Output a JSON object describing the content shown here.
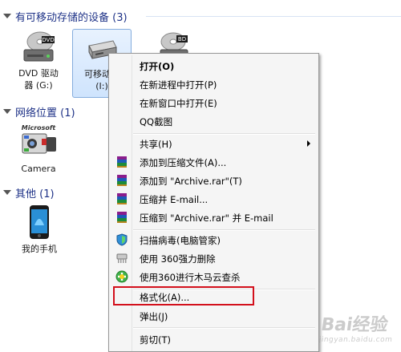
{
  "groups": {
    "removable": "有可移动存储的设备 (3)",
    "network": "网络位置 (1)",
    "other": "其他 (1)"
  },
  "devices": {
    "dvd": {
      "line1": "DVD 驱动",
      "line2": "器 (G:)",
      "badge": "DVD"
    },
    "removable": {
      "line1": "可移动磁",
      "line2": "(I:)"
    },
    "bd": {
      "badge": "BD"
    },
    "camera": {
      "label": "Camera",
      "badge": "Microsoft"
    },
    "phone": {
      "label": "我的手机"
    }
  },
  "context_menu": {
    "open": "打开(O)",
    "open_new_process": "在新进程中打开(P)",
    "open_new_window": "在新窗口中打开(E)",
    "qq_screenshot": "QQ截图",
    "share": "共享(H)",
    "add_to_archive": "添加到压缩文件(A)...",
    "add_to_rar": "添加到 \"Archive.rar\"(T)",
    "compress_email": "压缩并 E-mail...",
    "compress_rar_email": "压缩到 \"Archive.rar\" 并 E-mail",
    "scan_virus": "扫描病毒(电脑管家)",
    "force_delete_360": "使用 360强力删除",
    "trojan_scan_360": "使用360进行木马云查杀",
    "format": "格式化(A)...",
    "eject": "弹出(J)",
    "cut": "剪切(T)"
  },
  "watermark": {
    "brand": "Bai经验",
    "url": "jingyan.baidu.com"
  },
  "colors": {
    "highlight_box": "#d3101c",
    "group_text": "#1e3287"
  }
}
